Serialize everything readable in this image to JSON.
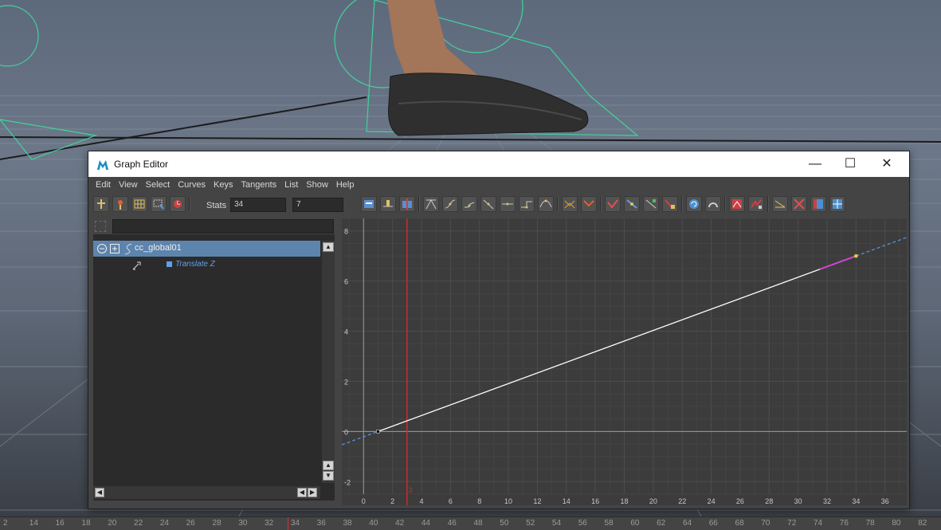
{
  "window": {
    "title": "Graph Editor",
    "controls": {
      "minimize": "—",
      "maximize": "☐",
      "close": "✕"
    }
  },
  "menu": [
    "Edit",
    "View",
    "Select",
    "Curves",
    "Keys",
    "Tangents",
    "List",
    "Show",
    "Help"
  ],
  "toolbar": {
    "stats_label": "Stats",
    "stats_value_1": "34",
    "stats_value_2": "7"
  },
  "outliner": {
    "node": "cc_global01",
    "attribute": "Translate Z"
  },
  "graph": {
    "y_ticks": [
      "8",
      "6",
      "4",
      "2",
      "0",
      "-2"
    ],
    "x_ticks": [
      "0",
      "2",
      "4",
      "6",
      "8",
      "10",
      "12",
      "14",
      "16",
      "18",
      "20",
      "22",
      "24",
      "26",
      "28",
      "30",
      "32",
      "34",
      "36"
    ],
    "current_frame": 3,
    "current_frame_label": "3",
    "curve_color": "#ffffff",
    "selected_segment_color": "#d442d4"
  },
  "chart_data": {
    "type": "line",
    "series": [
      {
        "name": "Translate Z",
        "x": [
          1,
          34
        ],
        "y": [
          0,
          7
        ]
      }
    ],
    "xlim": [
      -1.5,
      37.5
    ],
    "ylim": [
      -2.5,
      8.5
    ]
  },
  "time_ruler": {
    "ticks": [
      "2",
      "14",
      "16",
      "18",
      "20",
      "22",
      "24",
      "26",
      "28",
      "30",
      "32",
      "34",
      "36",
      "38",
      "40",
      "42",
      "44",
      "46",
      "48",
      "50",
      "52",
      "54",
      "56",
      "58",
      "60",
      "62",
      "64",
      "66",
      "68",
      "70",
      "72",
      "74",
      "76",
      "78",
      "80",
      "82"
    ],
    "current": "34"
  }
}
